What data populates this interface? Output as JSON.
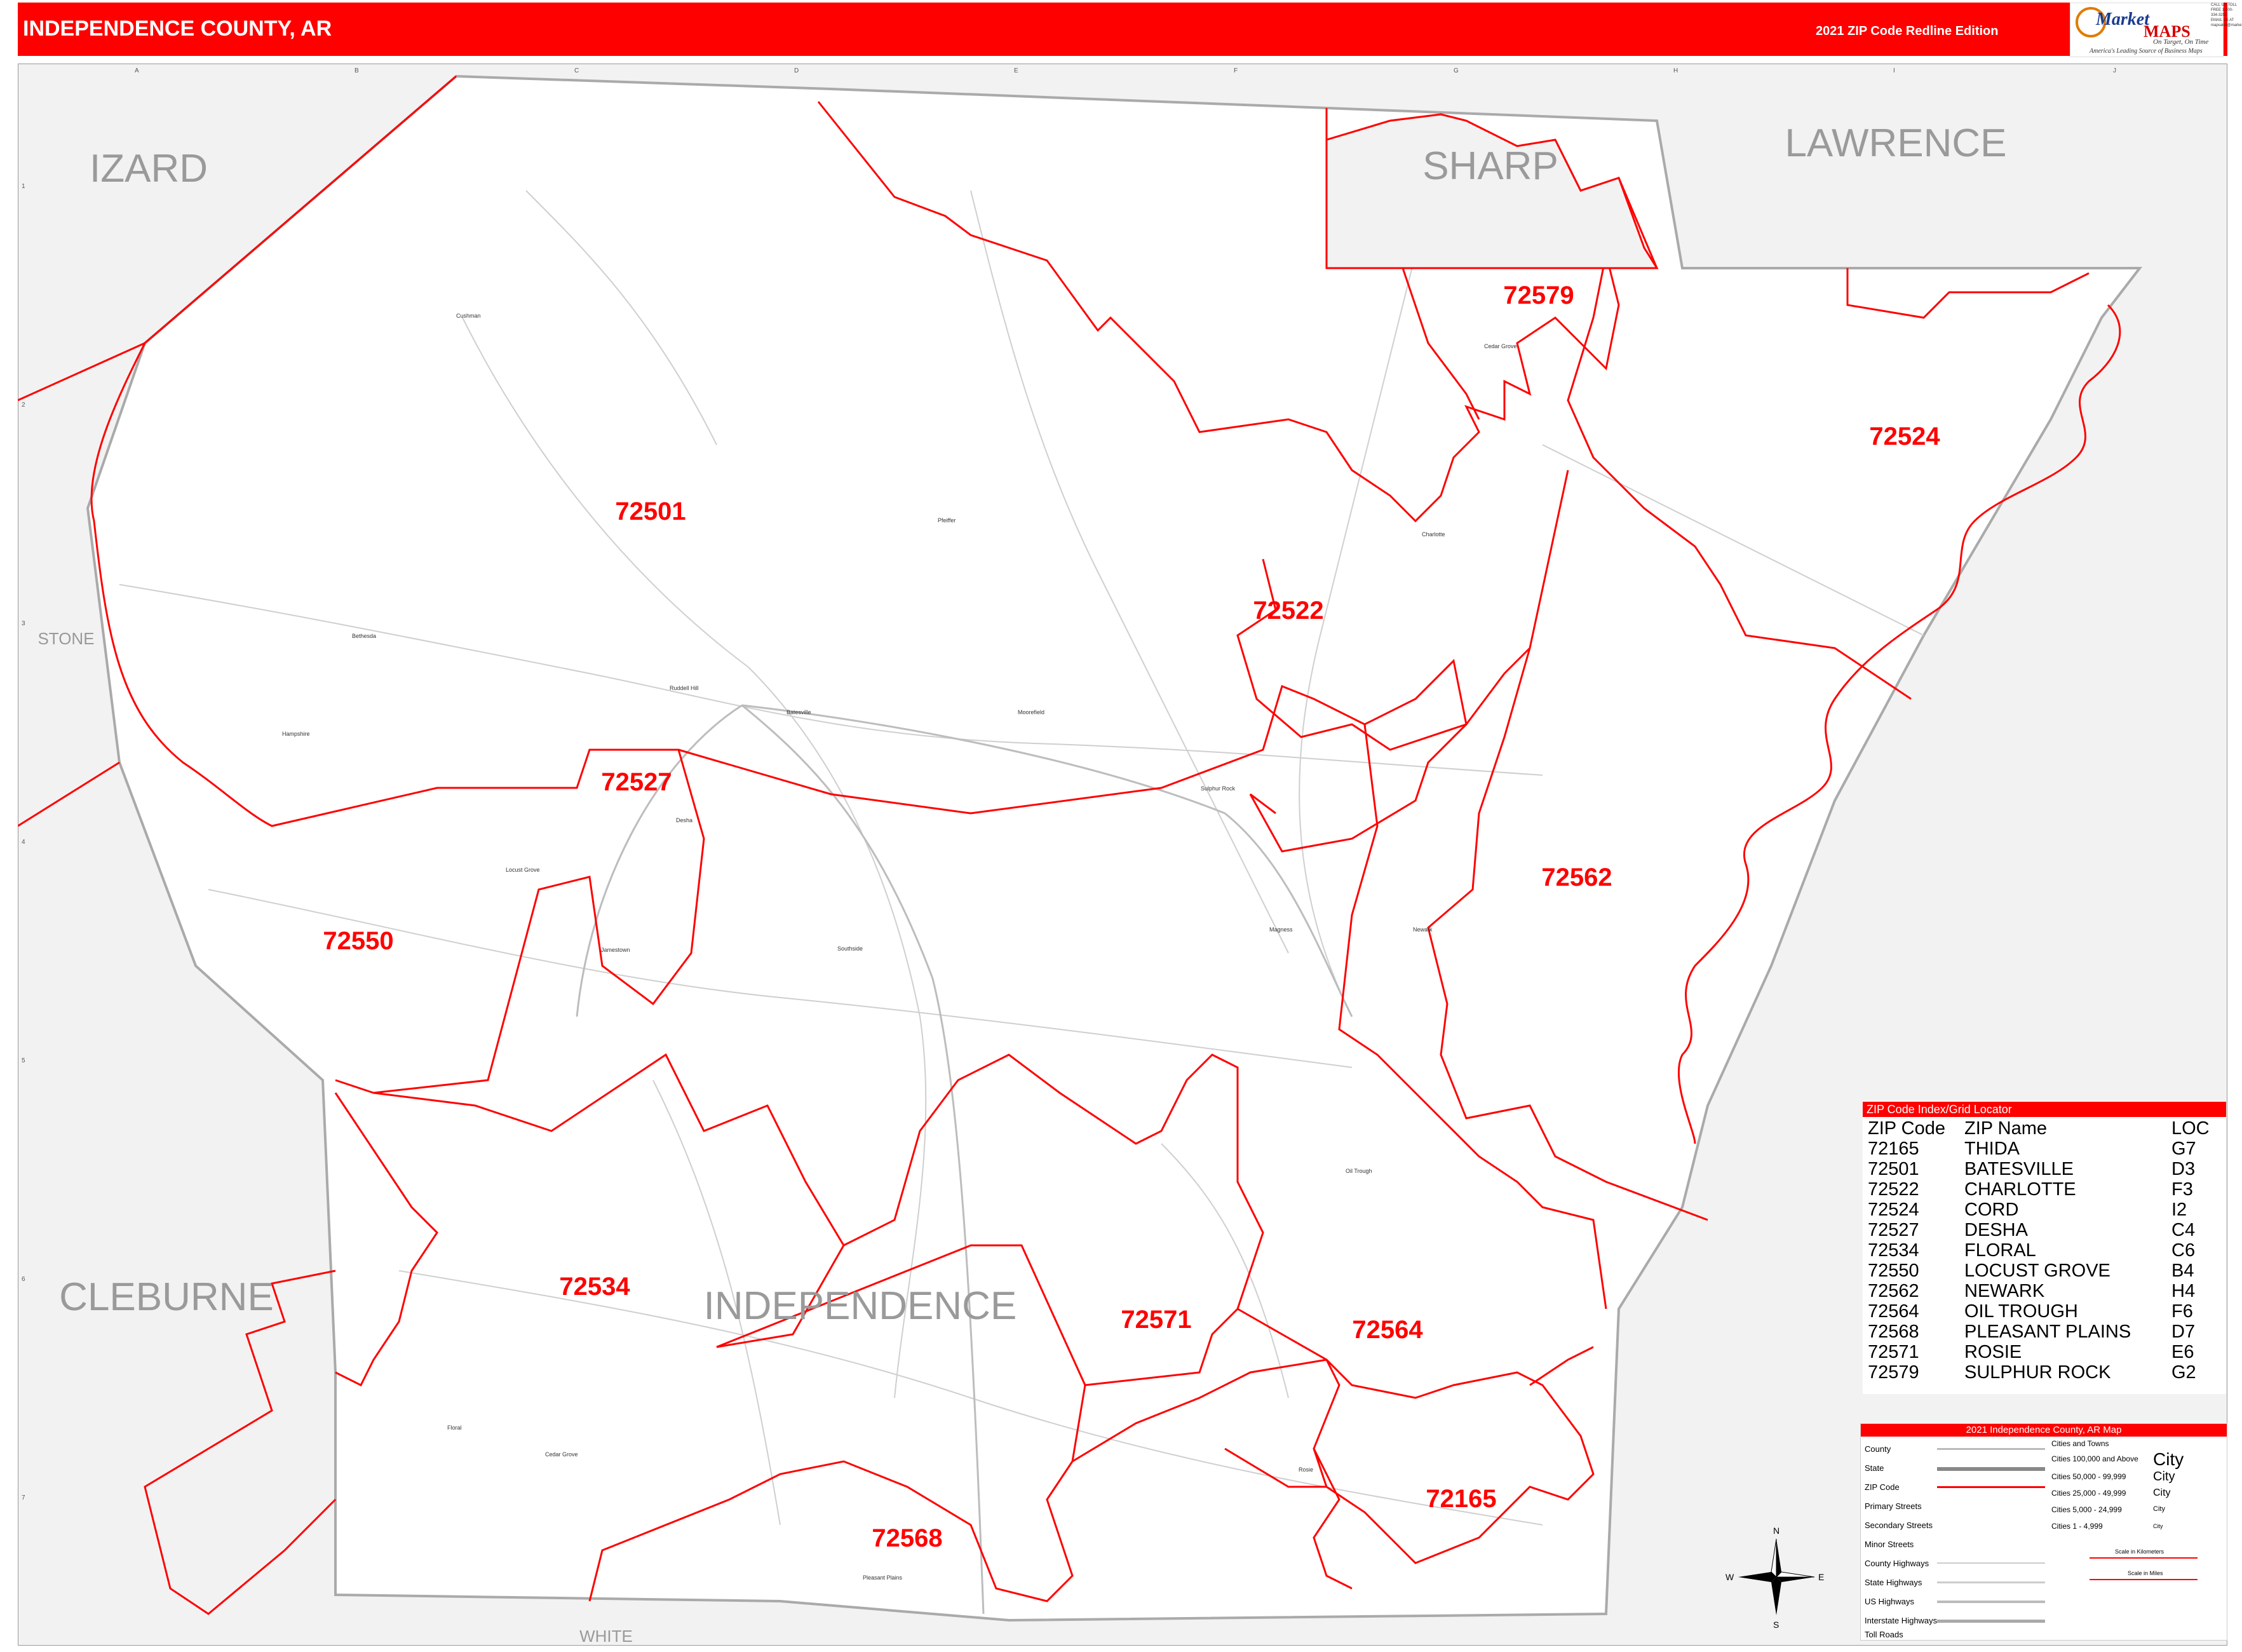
{
  "header": {
    "title": "INDEPENDENCE COUNTY, AR",
    "edition": "2021 ZIP Code Redline Edition",
    "logo_line1": "Market",
    "logo_line2": "MAPS",
    "logo_line3": "On Target, On Time",
    "logo_line4": "America's Leading Source of Business Maps",
    "contact": "CALL US TOLL FREE 1-800-334-3251 EMAIL US AT mapsales@marketmaps.com"
  },
  "colors": {
    "accent": "#ff0000",
    "zip_boundary": "#ff0000",
    "neighbor_fill": "#f2f2f2",
    "road": "#c8c8c8"
  },
  "map": {
    "county_labels": [
      "IZARD",
      "SHARP",
      "LAWRENCE",
      "STONE",
      "CLEBURNE",
      "INDEPENDENCE",
      "WHITE"
    ],
    "zip_labels": [
      "72501",
      "72579",
      "72524",
      "72522",
      "72527",
      "72550",
      "72562",
      "72534",
      "72571",
      "72564",
      "72165",
      "72568"
    ],
    "towns": [
      "Cushman",
      "Pfeiffer",
      "Cedar Grove",
      "Charlotte",
      "Bethesda",
      "Ruddell Hill",
      "Batesville",
      "Moorefield",
      "Sulphur Rock",
      "Hampshire",
      "Desha",
      "Locust Grove",
      "Jamestown",
      "Southside",
      "Magness",
      "Newark",
      "Oil Trough",
      "Floral",
      "Cedar Grove",
      "Pleasant Plains",
      "Rosie"
    ],
    "grid_columns": [
      "A",
      "B",
      "C",
      "D",
      "E",
      "F",
      "G",
      "H",
      "I",
      "J"
    ],
    "grid_rows": [
      "1",
      "2",
      "3",
      "4",
      "5",
      "6",
      "7"
    ],
    "compass": [
      "N",
      "S",
      "E",
      "W"
    ]
  },
  "zip_index": {
    "title": "ZIP Code Index/Grid Locator",
    "headers": [
      "ZIP Code",
      "ZIP Name",
      "LOC"
    ],
    "rows": [
      [
        "72165",
        "THIDA",
        "G7"
      ],
      [
        "72501",
        "BATESVILLE",
        "D3"
      ],
      [
        "72522",
        "CHARLOTTE",
        "F3"
      ],
      [
        "72524",
        "CORD",
        "I2"
      ],
      [
        "72527",
        "DESHA",
        "C4"
      ],
      [
        "72534",
        "FLORAL",
        "C6"
      ],
      [
        "72550",
        "LOCUST GROVE",
        "B4"
      ],
      [
        "72562",
        "NEWARK",
        "H4"
      ],
      [
        "72564",
        "OIL TROUGH",
        "F6"
      ],
      [
        "72568",
        "PLEASANT PLAINS",
        "D7"
      ],
      [
        "72571",
        "ROSIE",
        "E6"
      ],
      [
        "72579",
        "SULPHUR ROCK",
        "G2"
      ]
    ]
  },
  "legend": {
    "title": "2021 Independence County, AR Map",
    "rows": [
      "County",
      "State",
      "ZIP Code",
      "Primary Streets",
      "Secondary Streets",
      "Minor Streets",
      "County Highways",
      "State Highways",
      "US Highways",
      "Interstate Highways",
      "Toll Roads"
    ],
    "cities_header": "Cities and Towns",
    "cities": [
      [
        "Cities 100,000 and Above",
        "City"
      ],
      [
        "Cities 50,000 - 99,999",
        "City"
      ],
      [
        "Cities 25,000 - 49,999",
        "City"
      ],
      [
        "Cities 5,000 - 24,999",
        "City"
      ],
      [
        "Cities 1 - 4,999",
        "City"
      ]
    ],
    "scale_km": "Scale in Kilometers",
    "scale_mi": "Scale in Miles"
  }
}
